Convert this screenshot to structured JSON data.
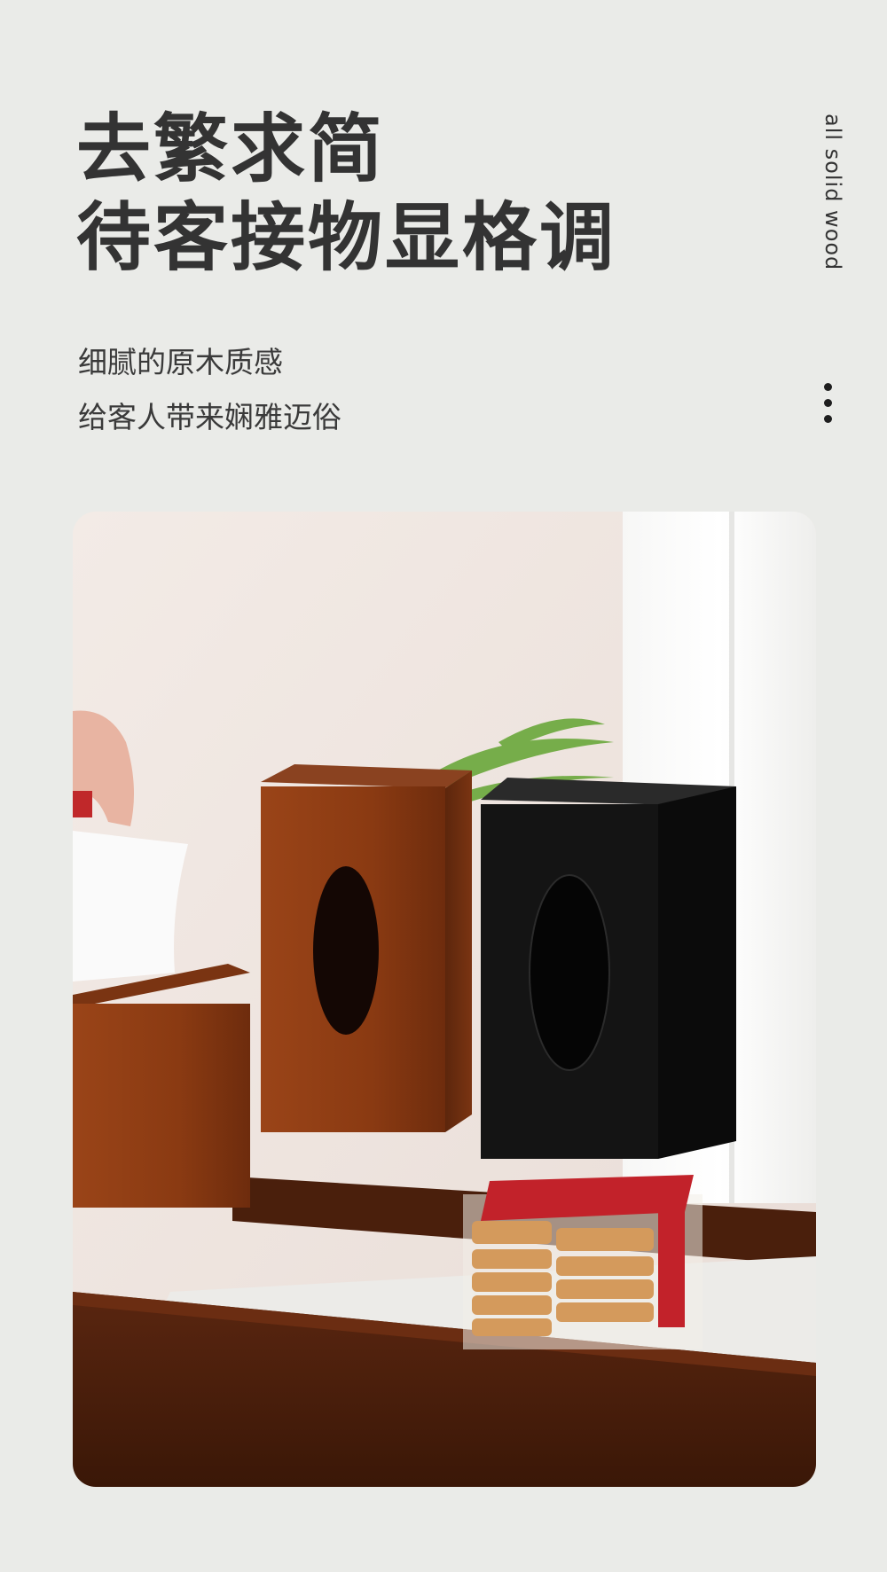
{
  "headline": {
    "line1": "去繁求简",
    "line2": "待客接物显格调"
  },
  "side_tag": "all solid wood",
  "subtext": {
    "line1": "细腻的原木质感",
    "line2": "给客人带来娴雅迈俗"
  },
  "more_icon": "vertical-dots-icon",
  "photo": {
    "subject": "wooden-tissue-boxes-photo",
    "colors": {
      "wall": "#efe6e0",
      "wood": "#8a3a12",
      "black_box": "#141414",
      "shelf": "#4a1f0c"
    }
  }
}
